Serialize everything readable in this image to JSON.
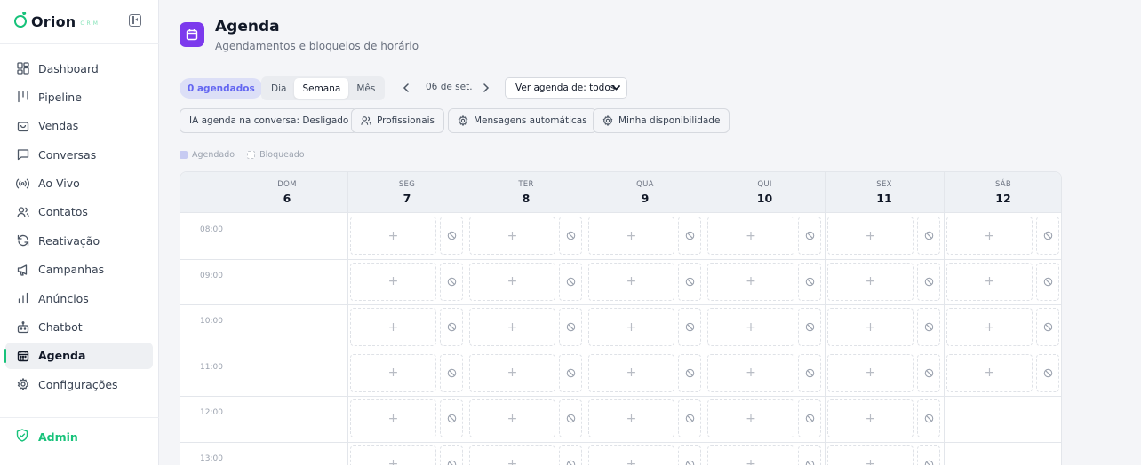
{
  "brand": {
    "name": "Orion",
    "suffix": "CRM"
  },
  "sidebar": {
    "items": [
      {
        "label": "Dashboard",
        "icon": "dashboard-icon"
      },
      {
        "label": "Pipeline",
        "icon": "pipeline-icon"
      },
      {
        "label": "Vendas",
        "icon": "shopping-bag-icon"
      },
      {
        "label": "Conversas",
        "icon": "chat-icon"
      },
      {
        "label": "Ao Vivo",
        "icon": "broadcast-icon"
      },
      {
        "label": "Contatos",
        "icon": "users-icon"
      },
      {
        "label": "Reativação",
        "icon": "refresh-icon"
      },
      {
        "label": "Campanhas",
        "icon": "megaphone-icon"
      },
      {
        "label": "Anúncios",
        "icon": "bar-chart-icon"
      },
      {
        "label": "Chatbot",
        "icon": "bot-icon"
      },
      {
        "label": "Agenda",
        "icon": "calendar-icon",
        "active": true
      },
      {
        "label": "Configurações",
        "icon": "gear-icon"
      }
    ],
    "admin_label": "Admin",
    "accent": "#17c27a"
  },
  "header": {
    "title": "Agenda",
    "subtitle": "Agendamentos e bloqueios de horário",
    "icon_color": "#7c3aed"
  },
  "toolbar": {
    "count_badge": "0 agendados",
    "views": [
      "Dia",
      "Semana",
      "Mês"
    ],
    "active_view": "Semana",
    "date_label": "06 de set.",
    "agenda_select": "Ver agenda de: todos"
  },
  "actions": {
    "ai_toggle": "IA agenda na conversa: Desligado",
    "professionals": "Profissionais",
    "auto_messages": "Mensagens automáticas",
    "availability": "Minha disponibilidade"
  },
  "legend": {
    "booked": "Agendado",
    "blocked": "Bloqueado"
  },
  "calendar": {
    "days": [
      {
        "name": "DOM",
        "date": "6"
      },
      {
        "name": "SEG",
        "date": "7"
      },
      {
        "name": "TER",
        "date": "8"
      },
      {
        "name": "QUA",
        "date": "9"
      },
      {
        "name": "QUI",
        "date": "10"
      },
      {
        "name": "SEX",
        "date": "11"
      },
      {
        "name": "SÁB",
        "date": "12"
      }
    ],
    "times": [
      "08:00",
      "09:00",
      "10:00",
      "11:00",
      "12:00",
      "13:00"
    ],
    "slot_plus": "+"
  }
}
